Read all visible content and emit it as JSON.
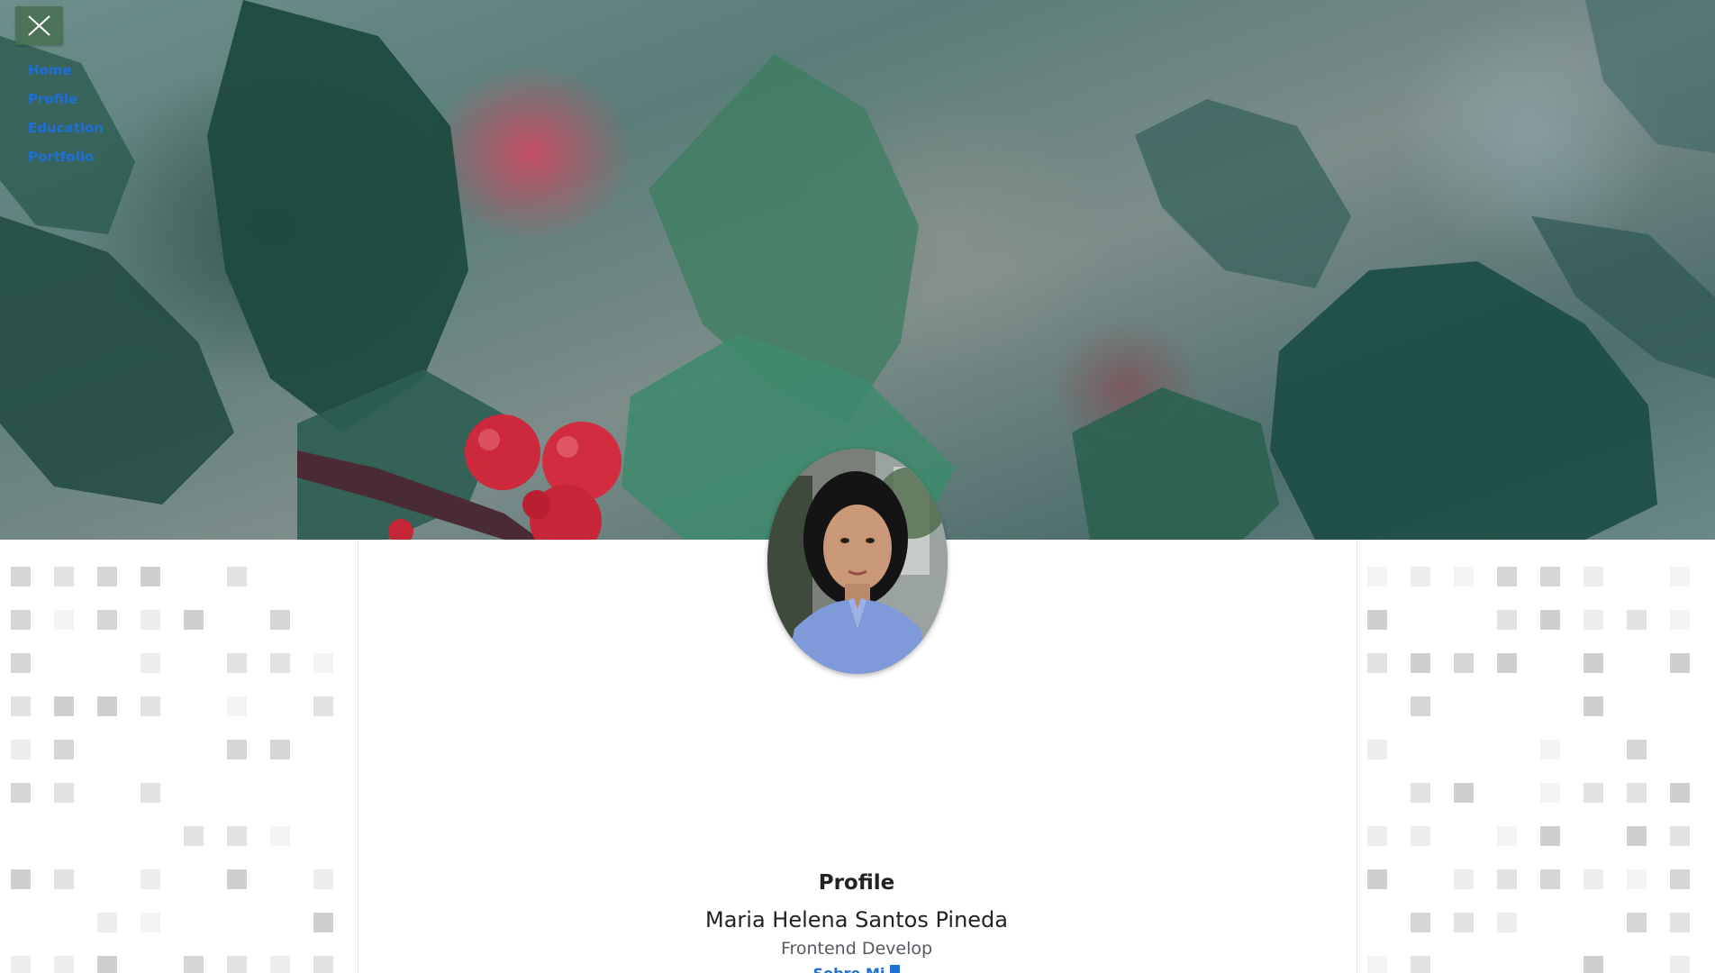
{
  "nav": {
    "toggle_icon": "close-icon",
    "items": [
      {
        "label": "Home"
      },
      {
        "label": "Profile"
      },
      {
        "label": "Education"
      },
      {
        "label": "Portfolio"
      }
    ],
    "link_color": "#1e6fd6"
  },
  "hero": {
    "image": "holly-leaves-red-berries",
    "dominant_colors": [
      "#2f5a4f",
      "#6c8f8c",
      "#c8283a"
    ]
  },
  "profile": {
    "avatar": "profile-photo",
    "section_heading": "Profile",
    "name": "Maria Helena Santos Pineda",
    "role": "Frontend Develop",
    "partial_line": "Sobre Mi"
  },
  "colors": {
    "accent": "#1e6fd6",
    "text": "#222222",
    "muted": "#555a60",
    "tile": "#dcdcdc"
  }
}
